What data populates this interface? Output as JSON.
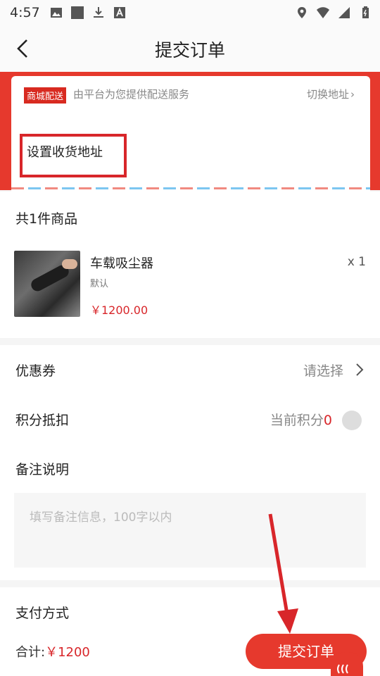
{
  "status_bar": {
    "time": "4:57",
    "left_icons": [
      "image-icon",
      "square-icon",
      "download-icon",
      "font-icon"
    ],
    "right_icons": [
      "location-icon",
      "wifi-icon",
      "signal-icon",
      "battery-icon"
    ]
  },
  "nav": {
    "back_icon": "chevron-left-icon",
    "title": "提交订单"
  },
  "address": {
    "badge": "商城配送",
    "service_text": "由平台为您提供配送服务",
    "switch_label": "切换地址",
    "switch_chevron": "›",
    "set_address": "设置收货地址"
  },
  "goods": {
    "count_label": "共1件商品",
    "items": [
      {
        "name": "车载吸尘器",
        "spec": "默认",
        "price": "￥1200.00",
        "qty": "x 1"
      }
    ]
  },
  "coupon": {
    "label": "优惠券",
    "value": "请选择"
  },
  "points": {
    "label": "积分抵扣",
    "prefix": "当前积分",
    "value": "0"
  },
  "remark": {
    "label": "备注说明",
    "placeholder": "填写备注信息，100字以内"
  },
  "payment": {
    "label": "支付方式",
    "total_label": "合计:",
    "total_value": "￥1200",
    "submit_label": "提交订单"
  },
  "colors": {
    "accent": "#e6392d",
    "price": "#d8262a",
    "annotation": "#d8262a"
  }
}
